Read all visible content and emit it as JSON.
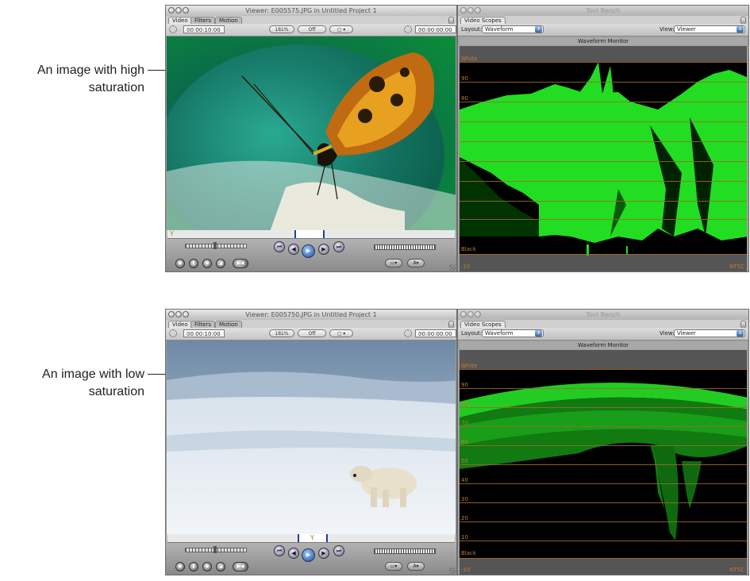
{
  "callouts": [
    {
      "line1": "An image with high",
      "line2": "saturation"
    },
    {
      "line1": "An image with low",
      "line2": "saturation"
    }
  ],
  "viewer1": {
    "title": "Viewer: E005575.JPG in Untitled Project 1",
    "tabs": [
      "Video",
      "Filters",
      "Motion"
    ],
    "timecode_left": "00:00:10:00",
    "timecode_right": "00:00:00:00",
    "zoom": "181%",
    "overlay": "Off"
  },
  "viewer2": {
    "title": "Viewer: E005750.JPG in Untitled Project 1",
    "tabs": [
      "Video",
      "Filters",
      "Motion"
    ],
    "timecode_left": "00:00:10:00",
    "timecode_right": "00:00:00:00",
    "zoom": "181%",
    "overlay": "Off"
  },
  "scope1": {
    "title": "Tool Bench",
    "tab": "Video Scopes",
    "layout_label": "Layout:",
    "layout_value": "Waveform",
    "view_label": "View:",
    "view_value": "Viewer",
    "header": "Waveform Monitor",
    "labels": {
      "white": "White",
      "l90": "90",
      "l80": "80",
      "l70": "70",
      "black": "Black",
      "neg10": "-10",
      "ntsc": "NTSC"
    }
  },
  "scope2": {
    "title": "Tool Bench",
    "tab": "Video Scopes",
    "layout_label": "Layout:",
    "layout_value": "Waveform",
    "view_label": "View:",
    "view_value": "Viewer",
    "header": "Waveform Monitor",
    "labels": {
      "white": "White",
      "l90": "90",
      "l80": "80",
      "l70": "70",
      "l60": "60",
      "l50": "50",
      "l40": "40",
      "l30": "30",
      "l20": "20",
      "l10": "10",
      "black": "Black",
      "neg10": "-10",
      "ntsc": "NTSC"
    }
  },
  "colors": {
    "waveform_green": "#33ff33",
    "graticule": "#a06a28",
    "play_blue": "#1a4ea8"
  },
  "icons": [
    "rewind-icon",
    "play-icon",
    "forward-icon",
    "mark-in-icon",
    "mark-out-icon"
  ]
}
